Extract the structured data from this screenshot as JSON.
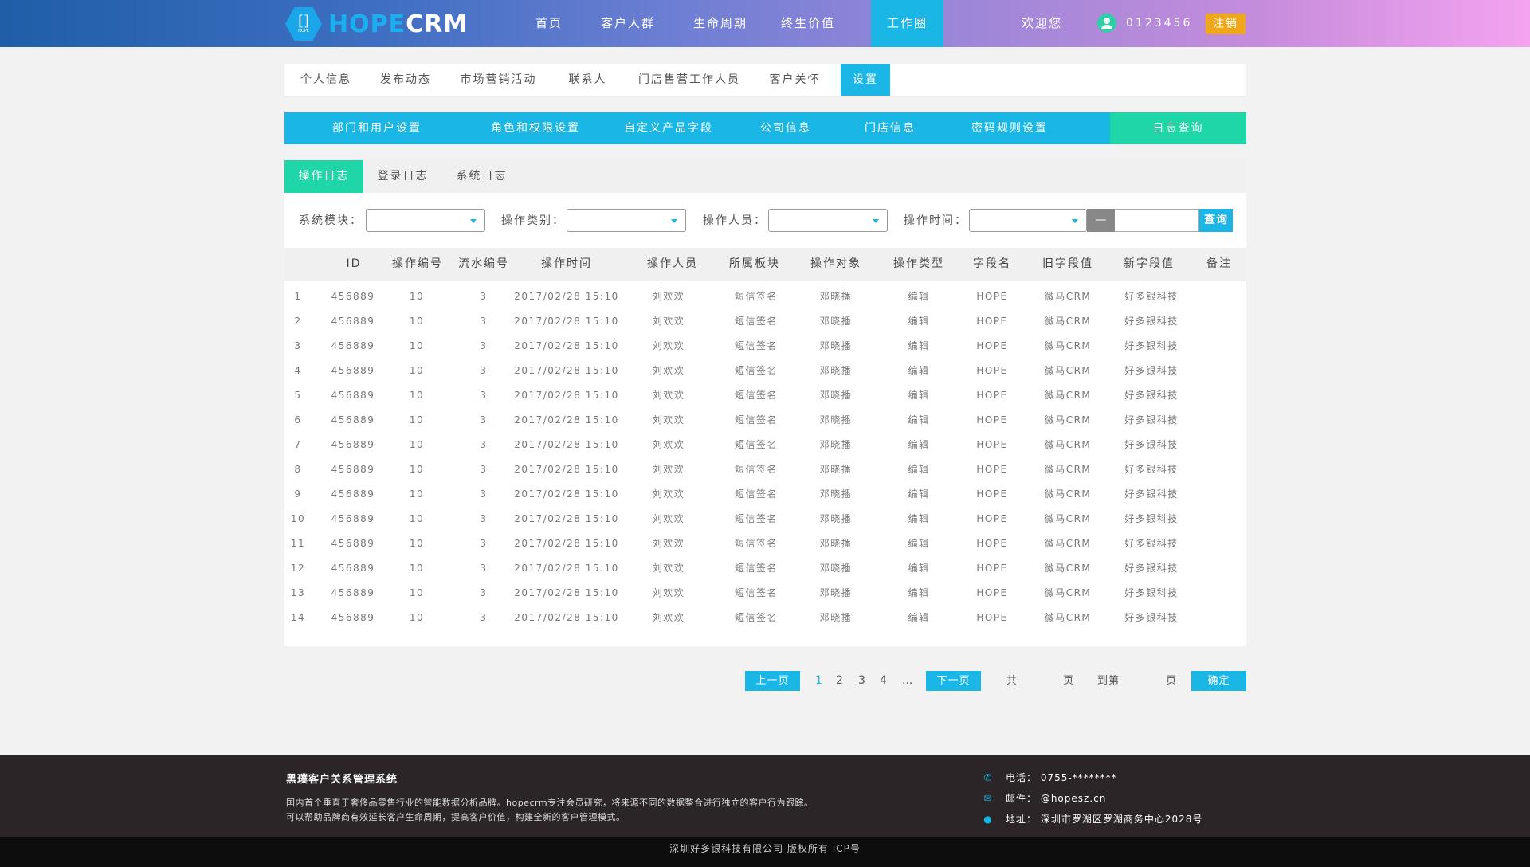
{
  "header": {
    "logo_text_a": "HOPE",
    "logo_text_b": "CRM",
    "logo_badge_main": "[]",
    "logo_badge_sub": "HOPE",
    "nav": [
      "首页",
      "客户人群",
      "生命周期",
      "终生价值",
      "工作圈"
    ],
    "active_nav": "工作圈",
    "welcome": "欢迎您",
    "user_id": "0123456",
    "logout": "注销"
  },
  "tabs_primary": [
    "个人信息",
    "发布动态",
    "市场营销活动",
    "联系人",
    "门店售营工作人员",
    "客户关怀",
    "设置"
  ],
  "tabs_primary_active": "设置",
  "tabs_secondary": [
    "部门和用户设置",
    "角色和权限设置",
    "自定义产品字段",
    "公司信息",
    "门店信息",
    "密码规则设置",
    "日志查询"
  ],
  "tabs_secondary_active": "日志查询",
  "tabs_log": [
    "操作日志",
    "登录日志",
    "系统日志"
  ],
  "tabs_log_active": "操作日志",
  "filters": {
    "module_label": "系统模块：",
    "type_label": "操作类别：",
    "operator_label": "操作人员：",
    "time_label": "操作时间：",
    "dash": "—",
    "query": "查询"
  },
  "table": {
    "columns": [
      "ID",
      "操作编号",
      "流水编号",
      "操作时间",
      "操作人员",
      "所属板块",
      "操作对象",
      "操作类型",
      "字段名",
      "旧字段值",
      "新字段值",
      "备注"
    ],
    "rows": [
      [
        "1",
        "456889",
        "10",
        "3",
        "2017/02/28 15:10",
        "刘欢欢",
        "短信签名",
        "邓晓播",
        "编辑",
        "HOPE",
        "微马CRM",
        "好多银科技",
        ""
      ],
      [
        "2",
        "456889",
        "10",
        "3",
        "2017/02/28 15:10",
        "刘欢欢",
        "短信签名",
        "邓晓播",
        "编辑",
        "HOPE",
        "微马CRM",
        "好多银科技",
        ""
      ],
      [
        "3",
        "456889",
        "10",
        "3",
        "2017/02/28 15:10",
        "刘欢欢",
        "短信签名",
        "邓晓播",
        "编辑",
        "HOPE",
        "微马CRM",
        "好多银科技",
        ""
      ],
      [
        "4",
        "456889",
        "10",
        "3",
        "2017/02/28 15:10",
        "刘欢欢",
        "短信签名",
        "邓晓播",
        "编辑",
        "HOPE",
        "微马CRM",
        "好多银科技",
        ""
      ],
      [
        "5",
        "456889",
        "10",
        "3",
        "2017/02/28 15:10",
        "刘欢欢",
        "短信签名",
        "邓晓播",
        "编辑",
        "HOPE",
        "微马CRM",
        "好多银科技",
        ""
      ],
      [
        "6",
        "456889",
        "10",
        "3",
        "2017/02/28 15:10",
        "刘欢欢",
        "短信签名",
        "邓晓播",
        "编辑",
        "HOPE",
        "微马CRM",
        "好多银科技",
        ""
      ],
      [
        "7",
        "456889",
        "10",
        "3",
        "2017/02/28 15:10",
        "刘欢欢",
        "短信签名",
        "邓晓播",
        "编辑",
        "HOPE",
        "微马CRM",
        "好多银科技",
        ""
      ],
      [
        "8",
        "456889",
        "10",
        "3",
        "2017/02/28 15:10",
        "刘欢欢",
        "短信签名",
        "邓晓播",
        "编辑",
        "HOPE",
        "微马CRM",
        "好多银科技",
        ""
      ],
      [
        "9",
        "456889",
        "10",
        "3",
        "2017/02/28 15:10",
        "刘欢欢",
        "短信签名",
        "邓晓播",
        "编辑",
        "HOPE",
        "微马CRM",
        "好多银科技",
        ""
      ],
      [
        "10",
        "456889",
        "10",
        "3",
        "2017/02/28 15:10",
        "刘欢欢",
        "短信签名",
        "邓晓播",
        "编辑",
        "HOPE",
        "微马CRM",
        "好多银科技",
        ""
      ],
      [
        "11",
        "456889",
        "10",
        "3",
        "2017/02/28 15:10",
        "刘欢欢",
        "短信签名",
        "邓晓播",
        "编辑",
        "HOPE",
        "微马CRM",
        "好多银科技",
        ""
      ],
      [
        "12",
        "456889",
        "10",
        "3",
        "2017/02/28 15:10",
        "刘欢欢",
        "短信签名",
        "邓晓播",
        "编辑",
        "HOPE",
        "微马CRM",
        "好多银科技",
        ""
      ],
      [
        "13",
        "456889",
        "10",
        "3",
        "2017/02/28 15:10",
        "刘欢欢",
        "短信签名",
        "邓晓播",
        "编辑",
        "HOPE",
        "微马CRM",
        "好多银科技",
        ""
      ],
      [
        "14",
        "456889",
        "10",
        "3",
        "2017/02/28 15:10",
        "刘欢欢",
        "短信签名",
        "邓晓播",
        "编辑",
        "HOPE",
        "微马CRM",
        "好多银科技",
        ""
      ]
    ]
  },
  "pagination": {
    "prev": "上一页",
    "pages": [
      "1",
      "2",
      "3",
      "4",
      "..."
    ],
    "current": "1",
    "next": "下一页",
    "total_prefix": "共",
    "total_suffix": "页",
    "goto_prefix": "到第",
    "goto_suffix": "页",
    "confirm": "确定"
  },
  "footer": {
    "title": "黑璞客户关系管理系统",
    "desc_line1": "国内首个垂直于奢侈品零售行业的智能数据分析品牌。hopecrm专注会员研究，将来源不同的数据整合进行独立的客户行为跟踪。",
    "desc_line2": "可以帮助品牌商有效延长客户生命周期，提高客户价值，构建全新的客户管理模式。",
    "phone": "电话：  0755-********",
    "email": "邮件：  @hopesz.cn",
    "address": "地址：  深圳市罗湖区罗湖商务中心2028号",
    "copyright": "深圳好多银科技有限公司 版权所有 ICP号"
  },
  "colors": {
    "accent": "#1ab6e6",
    "active_green": "#1ed6a8",
    "logout": "#f0a81a",
    "footer_bg": "#2b2527"
  },
  "icons": [
    "phone-icon",
    "mail-icon",
    "location-icon",
    "dropdown-arrow-icon",
    "user-avatar-icon"
  ]
}
